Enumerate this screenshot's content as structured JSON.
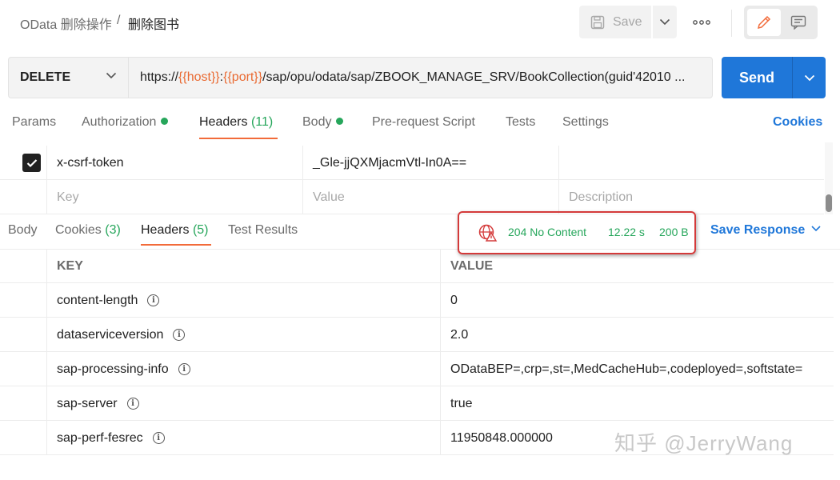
{
  "breadcrumb": {
    "parent": "OData 删除操作",
    "separator": "/",
    "current": "删除图书"
  },
  "toolbar": {
    "save_label": "Save",
    "more_label": "ooo"
  },
  "request": {
    "method": "DELETE",
    "url_prefix": "https://",
    "url_var_host": "{{host}}",
    "url_colon": ":",
    "url_var_port": "{{port}}",
    "url_path": "/sap/opu/odata/sap/ZBOOK_MANAGE_SRV/BookCollection(guid'42010 ...",
    "send_label": "Send"
  },
  "request_tabs": {
    "params": "Params",
    "authorization": "Authorization",
    "headers": "Headers",
    "headers_count": "(11)",
    "body": "Body",
    "pre_request": "Pre-request Script",
    "tests": "Tests",
    "settings": "Settings",
    "cookies": "Cookies"
  },
  "request_headers": {
    "row": {
      "key": "x-csrf-token",
      "value": "_Gle-jjQXMjacmVtl-In0A=="
    },
    "placeholders": {
      "key": "Key",
      "value": "Value",
      "description": "Description"
    }
  },
  "response_tabs": {
    "body": "Body",
    "cookies": "Cookies",
    "cookies_count": "(3)",
    "headers": "Headers",
    "headers_count": "(5)",
    "test_results": "Test Results",
    "save_response": "Save Response"
  },
  "status": {
    "code_text": "204 No Content",
    "time": "12.22 s",
    "size": "200 B",
    "color": "#26a65b"
  },
  "response_headers": {
    "columns": {
      "key": "KEY",
      "value": "VALUE"
    },
    "rows": [
      {
        "key": "content-length",
        "value": "0"
      },
      {
        "key": "dataserviceversion",
        "value": "2.0"
      },
      {
        "key": "sap-processing-info",
        "value": "ODataBEP=,crp=,st=,MedCacheHub=,codeployed=,softstate="
      },
      {
        "key": "sap-server",
        "value": "true"
      },
      {
        "key": "sap-perf-fesrec",
        "value": "11950848.000000"
      }
    ]
  },
  "watermark": "知乎 @JerryWang",
  "colors": {
    "accent_blue": "#1f77d9",
    "accent_orange": "#f26b3a",
    "success_green": "#26a65b",
    "highlight_red": "#d43a3a"
  }
}
